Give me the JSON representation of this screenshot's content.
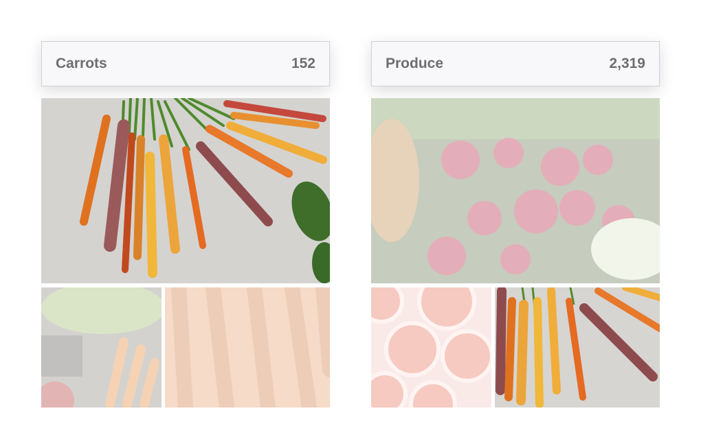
{
  "collections": [
    {
      "title": "Carrots",
      "count": "152"
    },
    {
      "title": "Produce",
      "count": "2,319"
    }
  ]
}
